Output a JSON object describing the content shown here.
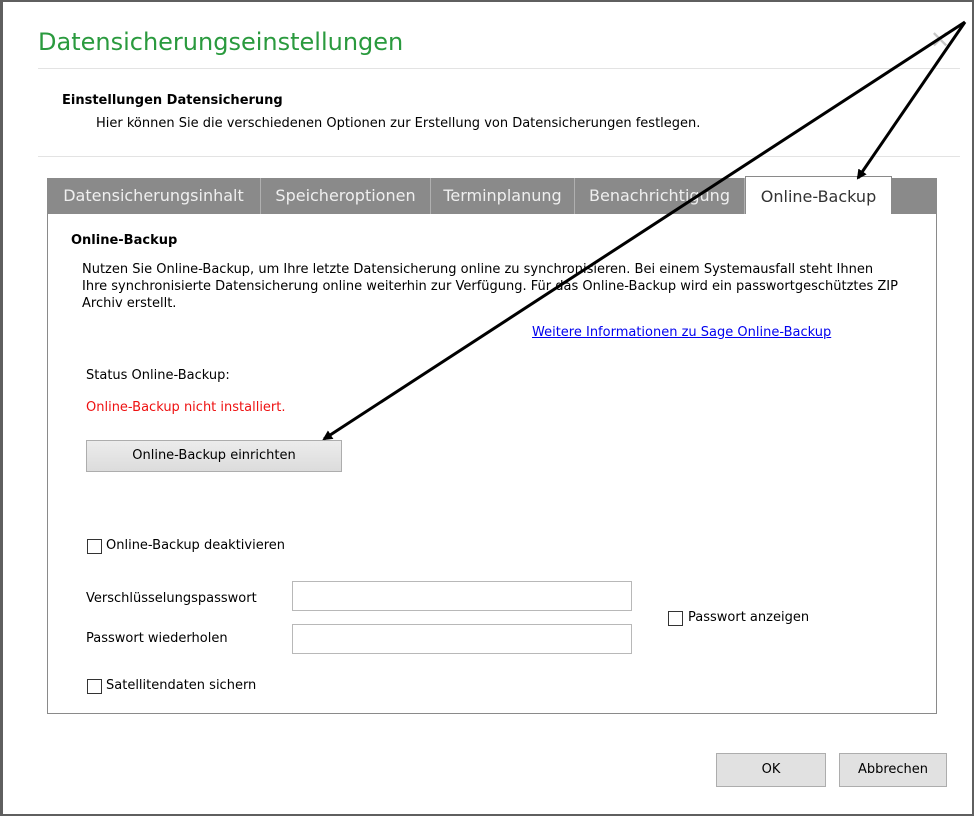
{
  "window": {
    "title": "Datensicherungseinstellungen",
    "close_glyph": "✕"
  },
  "header": {
    "section_title": "Einstellungen Datensicherung",
    "description": "Hier können Sie die verschiedenen Optionen zur Erstellung von Datensicherungen festlegen."
  },
  "tabs": [
    {
      "label": "Datensicherungsinhalt",
      "active": false
    },
    {
      "label": "Speicheroptionen",
      "active": false
    },
    {
      "label": "Terminplanung",
      "active": false
    },
    {
      "label": "Benachrichtigung",
      "active": false
    },
    {
      "label": "Online-Backup",
      "active": true
    }
  ],
  "online_backup": {
    "heading": "Online-Backup",
    "description": "Nutzen Sie Online-Backup, um Ihre letzte Datensicherung online zu synchronisieren. Bei einem Systemausfall steht Ihnen Ihre synchronisierte Datensicherung online weiterhin zur Verfügung. Für das Online-Backup wird ein passwortgeschütztes ZIP Archiv erstellt.",
    "info_link": "Weitere Informationen zu Sage Online-Backup",
    "status_label": "Status Online-Backup:",
    "status_value": "Online-Backup nicht installiert.",
    "setup_button": "Online-Backup einrichten",
    "deactivate_label": "Online-Backup deaktivieren",
    "deactivate_checked": false,
    "password_label": "Verschlüsselungspasswort",
    "password_value": "",
    "repeat_password_label": "Passwort wiederholen",
    "repeat_password_value": "",
    "show_password_label": "Passwort anzeigen",
    "show_password_checked": false,
    "satellite_label": "Satellitendaten sichern",
    "satellite_checked": false
  },
  "footer": {
    "ok_label": "OK",
    "cancel_label": "Abbrechen"
  },
  "colors": {
    "title_green": "#2a9a3e",
    "tab_bar": "#8a8a8a",
    "error_red": "#ee1111",
    "link_blue": "#0000ee",
    "annotation_arrows": "#000000"
  }
}
